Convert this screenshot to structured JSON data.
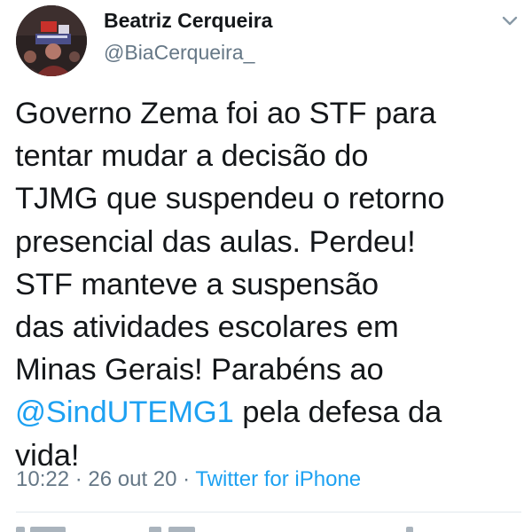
{
  "user": {
    "display_name": "Beatriz Cerqueira",
    "handle": "@BiaCerqueira_"
  },
  "icons": {
    "menu": "chevron-down-icon",
    "avatar": "avatar"
  },
  "tweet": {
    "lines": [
      "Governo Zema foi ao STF para",
      "tentar mudar a decisão do",
      "TJMG que suspendeu o retorno",
      "presencial das aulas. Perdeu!",
      "STF manteve a suspensão",
      "das atividades escolares em",
      "Minas Gerais! Parabéns ao"
    ],
    "mention": "@SindUTEMG1",
    "after_mention": " pela defesa da",
    "last_line": "vida!"
  },
  "meta": {
    "time": "10:22",
    "sep1": " · ",
    "date": "26 out 20",
    "sep2": " · ",
    "source": "Twitter for iPhone"
  },
  "colors": {
    "text": "#14171a",
    "secondary": "#657786",
    "link": "#1da1f2",
    "divider": "#e1e8ed"
  }
}
